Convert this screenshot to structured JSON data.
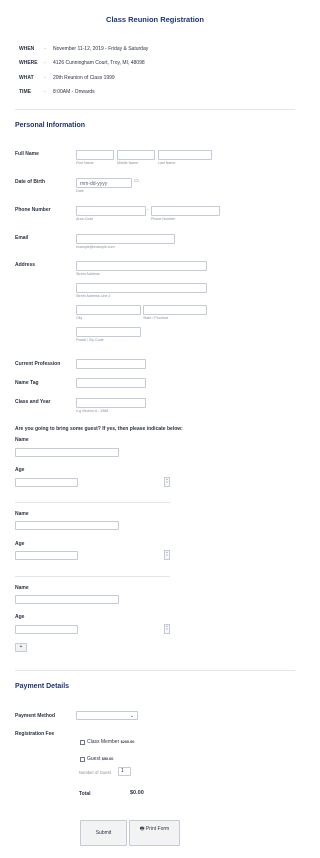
{
  "form": {
    "title": "Class Reunion Registration",
    "event_info": [
      {
        "key": "WHEN",
        "sep": "-",
        "value": "November 11-12, 2019 - Friday & Saturday"
      },
      {
        "key": "WHERE",
        "sep": "-",
        "value": "4126 Cunningham Court, Troy, MI, 48098"
      },
      {
        "key": "WHAT",
        "sep": "-",
        "value": "20th Reunion of Class 1999"
      },
      {
        "key": "TIME",
        "sep": "-",
        "value": "8:00AM - Onwards"
      }
    ]
  },
  "personal": {
    "heading": "Personal Information",
    "full_name": {
      "label": "Full Name",
      "first": "First Name",
      "middle": "Middle Name",
      "last": "Last Name"
    },
    "dob": {
      "label": "Date of Birth",
      "placeholder": "mm-dd-yyyy",
      "sub": "Date",
      "icon": "calendar-icon"
    },
    "phone": {
      "label": "Phone Number",
      "area": "Area Code",
      "number": "Phone Number",
      "sep": "-"
    },
    "email": {
      "label": "Email",
      "sub": "example@example.com"
    },
    "address": {
      "label": "Address",
      "street": "Street Address",
      "street2": "Street Address Line 2",
      "city": "City",
      "state": "State / Province",
      "postal": "Postal / Zip Code"
    },
    "profession": {
      "label": "Current Profession"
    },
    "name_tag": {
      "label": "Name Tag"
    },
    "class_year": {
      "label": "Class and Year",
      "sub": "e.g Section A - 1988"
    }
  },
  "guests": {
    "question": "Are you going to bring some guest? If yes, then please indicate below:",
    "entries": [
      {
        "name_label": "Name",
        "age_label": "Age"
      },
      {
        "name_label": "Name",
        "age_label": "Age"
      },
      {
        "name_label": "Name",
        "age_label": "Age"
      }
    ],
    "spinner_up": "▲",
    "spinner_down": "▼",
    "add_label": "+"
  },
  "payment": {
    "heading": "Payment Details",
    "method_label": "Payment Method",
    "method_value": "",
    "fee_label": "Registration Fee",
    "options": [
      {
        "label": "Class Member",
        "price": "$200.00",
        "checked": false
      },
      {
        "label": "Guest",
        "price": "$50.00",
        "checked": false
      }
    ],
    "guest_count_label": "Number of Guest",
    "guest_count_value": "1",
    "total_label": "Total",
    "total_value": "$0.00"
  },
  "actions": {
    "submit": "Submit",
    "print": "Print Form",
    "print_icon": "printer-icon"
  }
}
